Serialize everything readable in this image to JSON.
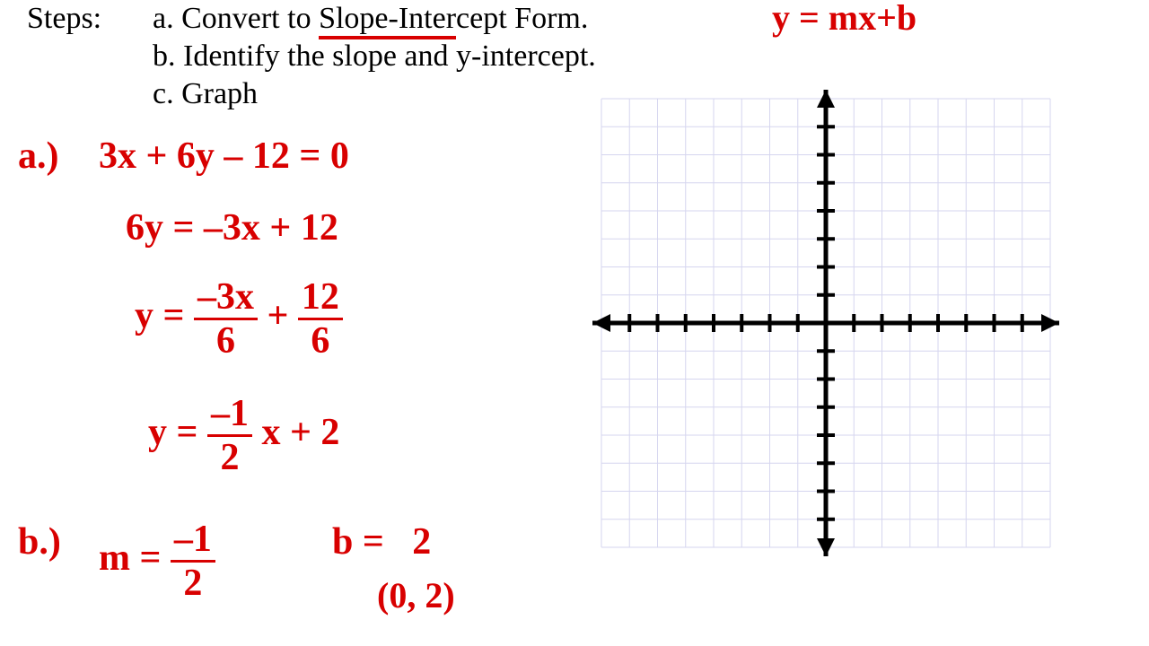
{
  "steps_label": "Steps:",
  "step_a_pre": "a. Convert to ",
  "step_a_underlined": "Slope-Inter",
  "step_a_post": "cept Form.",
  "step_b": "b. Identify the slope and y-intercept.",
  "step_c": "c. Graph",
  "formula_top": "y = mx+b",
  "work": {
    "a_label": "a.)",
    "eq1": "3x + 6y – 12 = 0",
    "eq2": "6y = –3x + 12",
    "eq3_lhs": "y =",
    "eq3_n1": "–3x",
    "eq3_d1": "6",
    "eq3_plus": "+",
    "eq3_n2": "12",
    "eq3_d2": "6",
    "eq4_lhs": "y =",
    "eq4_n": "–1",
    "eq4_d": "2",
    "eq4_rest": "x + 2",
    "b_label": "b.)",
    "m_lhs": "m =",
    "m_n": "–1",
    "m_d": "2",
    "b_text": "b =   2",
    "pt": "(0, 2)"
  },
  "chart_data": {
    "type": "empty-grid",
    "x_range": [
      -8,
      8
    ],
    "y_range": [
      -8,
      8
    ],
    "tick_step": 1,
    "title": "",
    "xlabel": "",
    "ylabel": "",
    "series": []
  }
}
